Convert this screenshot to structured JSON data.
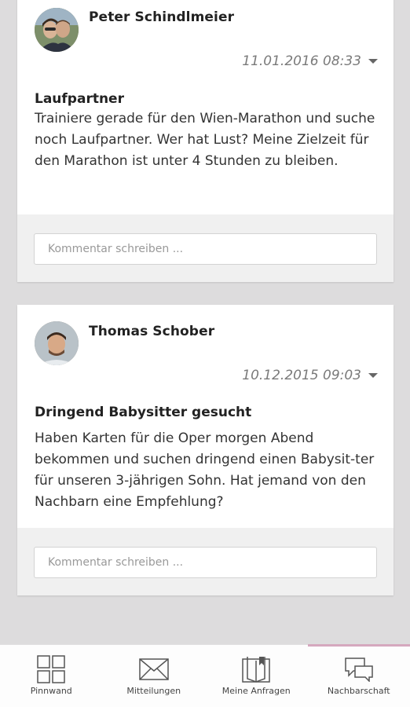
{
  "posts": [
    {
      "author": "Peter Schindlmeier",
      "timestamp": "11.01.2016 08:33",
      "title": "Laufpartner",
      "body": "Trainiere gerade für den Wien-Marathon und suche noch Laufpartner. Wer hat Lust? Meine Zielzeit für den Marathon ist unter 4 Stunden zu bleiben.",
      "comment_placeholder": "Kommentar schreiben ..."
    },
    {
      "author": "Thomas Schober",
      "timestamp": "10.12.2015 09:03",
      "title": "Dringend Babysitter gesucht",
      "body": "Haben Karten für die Oper morgen Abend bekommen und suchen dringend einen Babysit-ter für unseren 3-jährigen Sohn. Hat jemand von den Nachbarn eine Empfehlung?",
      "comment_placeholder": "Kommentar schreiben ..."
    }
  ],
  "tabs": [
    {
      "label": "Pinnwand",
      "icon": "grid-icon"
    },
    {
      "label": "Mitteilungen",
      "icon": "envelope-icon"
    },
    {
      "label": "Meine Anfragen",
      "icon": "book-icon"
    },
    {
      "label": "Nachbarschaft",
      "icon": "chat-bubbles-icon",
      "active": true
    }
  ],
  "colors": {
    "background": "#dddcdd",
    "active_tab_accent": "#d5a8be",
    "card": "#ffffff",
    "comment_area": "#f0f0f0"
  }
}
